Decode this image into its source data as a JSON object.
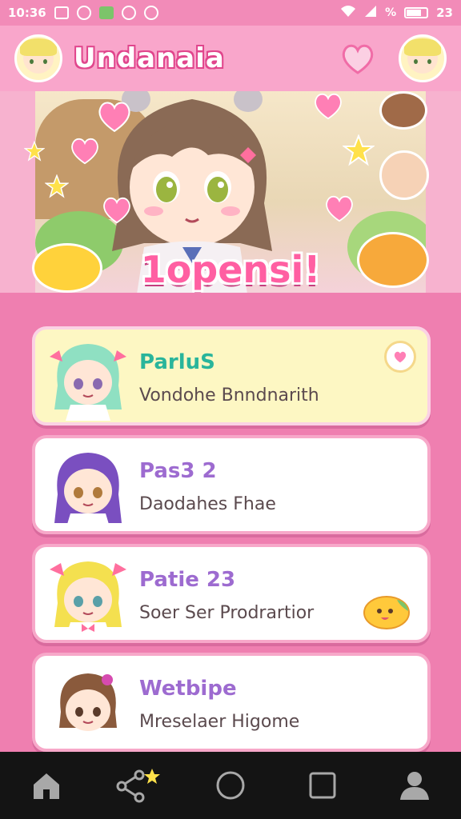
{
  "status_bar": {
    "time": "10:36",
    "battery_text": "23",
    "icons": [
      "gallery-icon",
      "app-icon",
      "android-icon",
      "play-icon",
      "sync-icon",
      "wifi-icon",
      "signal-icon",
      "percent-icon",
      "battery-icon"
    ]
  },
  "header": {
    "title": "Undanaia",
    "left_icon": "avatar-icon",
    "right_icons": [
      "heart-icon",
      "avatar-icon"
    ]
  },
  "banner": {
    "title": "1opensi!"
  },
  "list": {
    "items": [
      {
        "title": "ParluS",
        "subtitle": "Vondohe Bnndnarith",
        "active": true,
        "hair": "#8fe0c2",
        "bow": "#ff6f9e",
        "action": "heart-icon"
      },
      {
        "title": "Pas3 2",
        "subtitle": "Daodahes Fhae",
        "active": false,
        "hair": "#7a4fc0",
        "bow": "#ffffff"
      },
      {
        "title": "Patie 23",
        "subtitle": "Soer Ser Prodrartior",
        "active": false,
        "hair": "#f4e04f",
        "bow": "#ff6f9e",
        "sticker": "bread-mascot-icon"
      },
      {
        "title": "Wetbipe",
        "subtitle": "Mreselaer Higome",
        "active": false,
        "hair": "#8a5a3c",
        "bow": "#d64bb0"
      }
    ]
  },
  "nav": {
    "items": [
      "home-icon",
      "share-icon",
      "circle-home-icon",
      "square-recents-icon",
      "profile-icon"
    ]
  },
  "colors": {
    "background": "#ef7fb0",
    "header": "#f9a6cb",
    "accent_pink": "#ff5fa2",
    "title_teal": "#29b59b",
    "title_purple": "#9d6bd0"
  }
}
